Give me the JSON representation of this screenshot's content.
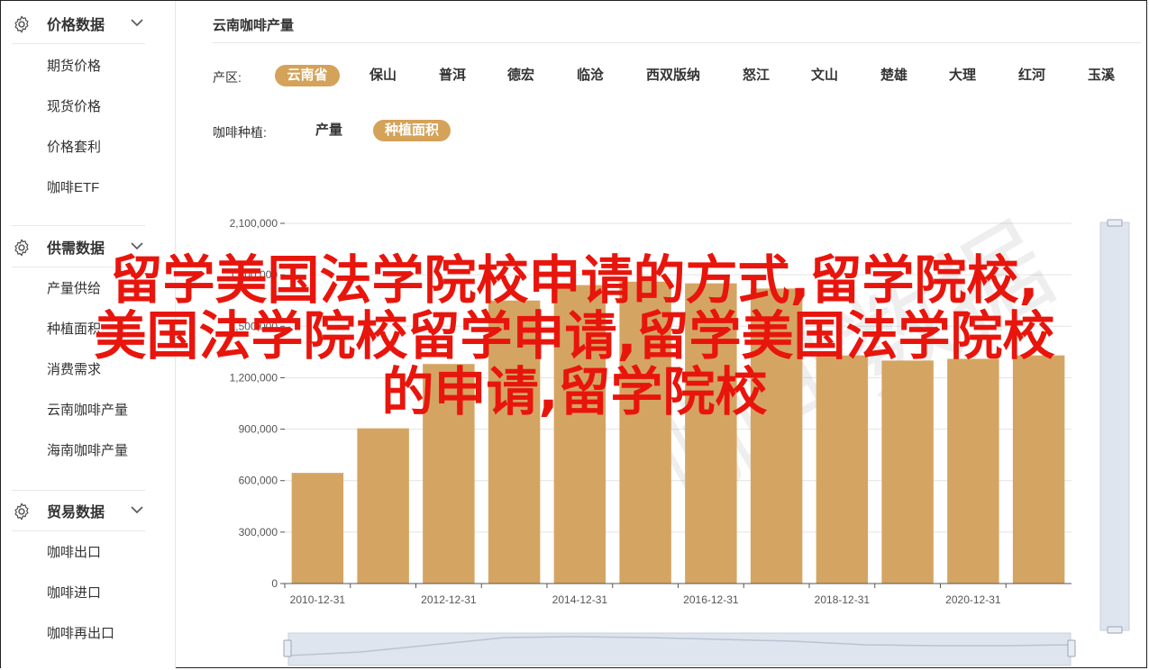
{
  "sidebar": {
    "sections": [
      {
        "title": "价格数据",
        "items": [
          "期货价格",
          "现货价格",
          "价格套利",
          "咖啡ETF"
        ]
      },
      {
        "title": "供需数据",
        "items": [
          "产量供给",
          "种植面积",
          "消费需求",
          "云南咖啡产量",
          "海南咖啡产量"
        ]
      },
      {
        "title": "贸易数据",
        "items": [
          "咖啡出口",
          "咖啡进口",
          "咖啡再出口"
        ]
      }
    ]
  },
  "main": {
    "title": "云南咖啡产量",
    "region_label": "产区:",
    "regions": [
      "云南省",
      "保山",
      "普洱",
      "德宏",
      "临沧",
      "西双版纳",
      "怒江",
      "文山",
      "楚雄",
      "大理",
      "红河",
      "玉溪"
    ],
    "region_selected": "云南省",
    "plant_label": "咖啡种植:",
    "plant_options": [
      "产量",
      "种植面积"
    ],
    "plant_selected": "种植面积"
  },
  "overlay": {
    "line1": "留学美国法学院校申请的方式,留学院校,",
    "line2": "美国法学院校留学申请,留学美国法学院校",
    "line3": "的申请,留学院校"
  },
  "colors": {
    "accent": "#d4a259",
    "overlay_text": "#e8150c"
  },
  "chart_data": {
    "type": "bar",
    "categories": [
      "2010-12-31",
      "2011-12-31",
      "2012-12-31",
      "2013-12-31",
      "2014-12-31",
      "2015-12-31",
      "2016-12-31",
      "2017-12-31",
      "2018-12-31",
      "2019-12-31",
      "2020-12-31",
      "2021-12-31"
    ],
    "x_tick_labels": [
      "2010-12-31",
      "2012-12-31",
      "2014-12-31",
      "2016-12-31",
      "2018-12-31",
      "2020-12-31"
    ],
    "values": [
      645000,
      905000,
      1280000,
      1650000,
      1740000,
      1760000,
      1750000,
      1720000,
      1330000,
      1300000,
      1310000,
      1330000
    ],
    "ylim": [
      0,
      2100000
    ],
    "y_ticks": [
      "0",
      "300,000",
      "600,000",
      "900,000",
      "1,200,000",
      "1,500,000",
      "1,800,000",
      "2,100,000"
    ],
    "y_tick_values": [
      0,
      300000,
      600000,
      900000,
      1200000,
      1500000,
      1800000,
      2100000
    ],
    "bar_color": "#d4a562",
    "grid": true
  }
}
